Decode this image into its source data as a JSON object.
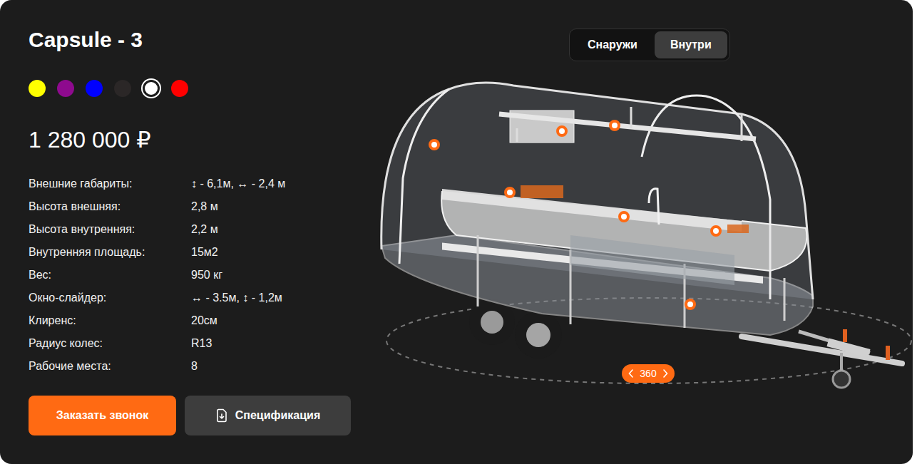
{
  "product": {
    "title": "Capsule - 3",
    "price": "1 280 000 ₽"
  },
  "colors": [
    {
      "color": "#ffff00",
      "selected": false
    },
    {
      "color": "#8e0a8e",
      "selected": false
    },
    {
      "color": "#0000ff",
      "selected": false
    },
    {
      "color": "#2b2727",
      "selected": false
    },
    {
      "color": "#ffffff",
      "selected": true
    },
    {
      "color": "#ff0000",
      "selected": false
    }
  ],
  "specs": [
    {
      "label": "Внешние габариты:",
      "value": "↕ - 6,1м, ↔ - 2,4 м"
    },
    {
      "label": "Высота внешняя:",
      "value": "2,8 м"
    },
    {
      "label": "Высота внутренняя:",
      "value": "2,2 м"
    },
    {
      "label": "Внутренняя площадь:",
      "value": "15м2"
    },
    {
      "label": "Вес:",
      "value": "950 кг"
    },
    {
      "label": "Окно-слайдер:",
      "value": "↔ - 3.5м, ↕ - 1,2м"
    },
    {
      "label": "Клиренс:",
      "value": "20см"
    },
    {
      "label": "Радиус колес:",
      "value": "R13"
    },
    {
      "label": "Рабочие места:",
      "value": "8"
    }
  ],
  "buttons": {
    "call": "Заказать звонок",
    "spec": "Спецификация"
  },
  "view_tabs": [
    {
      "label": "Снаружи",
      "selected": false
    },
    {
      "label": "Внутри",
      "selected": true
    }
  ],
  "rotate": {
    "label": "360"
  }
}
